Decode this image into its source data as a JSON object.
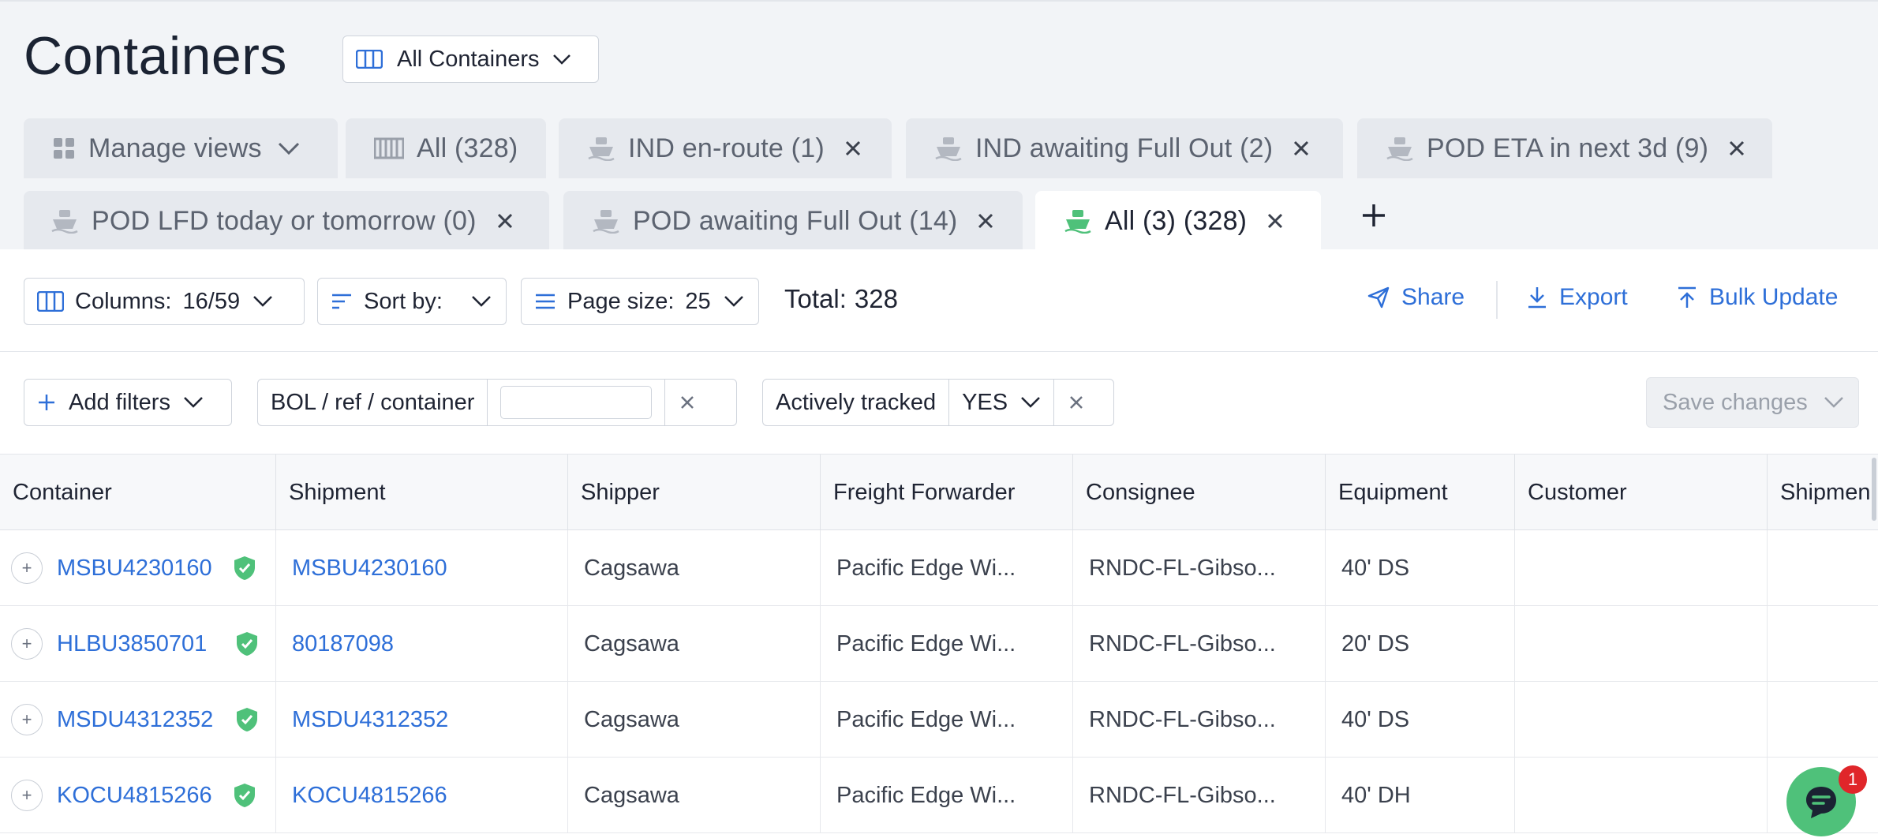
{
  "header": {
    "title": "Containers",
    "view_select": "All Containers"
  },
  "tabs_row1": [
    {
      "label": "Manage views",
      "icon": "grid-icon"
    },
    {
      "label": "All (328)",
      "icon": "columns-icon"
    },
    {
      "label": "IND en-route (1)",
      "icon": "ship-icon"
    },
    {
      "label": "IND awaiting Full Out (2)",
      "icon": "ship-icon"
    },
    {
      "label": "POD ETA in next 3d (9)",
      "icon": "ship-icon"
    }
  ],
  "tabs_row2": [
    {
      "label": "POD LFD today or tomorrow (0)",
      "icon": "ship-icon"
    },
    {
      "label": "POD awaiting Full Out (14)",
      "icon": "ship-icon"
    },
    {
      "label": "All (3) (328)",
      "icon": "ship-icon",
      "active": true
    }
  ],
  "toolbar": {
    "columns_label": "Columns:",
    "columns_value": "16/59",
    "sort_label": "Sort by:",
    "page_size_label": "Page size:",
    "page_size_value": "25",
    "total_label": "Total:",
    "total_value": "328",
    "share": "Share",
    "export": "Export",
    "bulk_update": "Bulk Update"
  },
  "filters": {
    "add_filters": "Add filters",
    "search_label": "BOL / ref / container",
    "search_value": "",
    "tracked_label": "Actively tracked",
    "tracked_value": "YES",
    "save_changes": "Save changes"
  },
  "table": {
    "columns": [
      "Container",
      "Shipment",
      "Shipper",
      "Freight Forwarder",
      "Consignee",
      "Equipment",
      "Customer",
      "Shipmen"
    ],
    "rows": [
      {
        "container": "MSBU4230160",
        "shipment": "MSBU4230160",
        "shipper": "Cagsawa",
        "forwarder": "Pacific Edge Wi...",
        "consignee": "RNDC-FL-Gibso...",
        "equipment": "40' DS",
        "customer": ""
      },
      {
        "container": "HLBU3850701",
        "shipment": "80187098",
        "shipper": "Cagsawa",
        "forwarder": "Pacific Edge Wi...",
        "consignee": "RNDC-FL-Gibso...",
        "equipment": "20' DS",
        "customer": ""
      },
      {
        "container": "MSDU4312352",
        "shipment": "MSDU4312352",
        "shipper": "Cagsawa",
        "forwarder": "Pacific Edge Wi...",
        "consignee": "RNDC-FL-Gibso...",
        "equipment": "40' DS",
        "customer": ""
      },
      {
        "container": "KOCU4815266",
        "shipment": "KOCU4815266",
        "shipper": "Cagsawa",
        "forwarder": "Pacific Edge Wi...",
        "consignee": "RNDC-FL-Gibso...",
        "equipment": "40' DH",
        "customer": ""
      }
    ]
  },
  "chat": {
    "badge_count": "1"
  },
  "colors": {
    "accent": "#2e6fd8",
    "success": "#4fc17a",
    "alert": "#e0262a"
  }
}
